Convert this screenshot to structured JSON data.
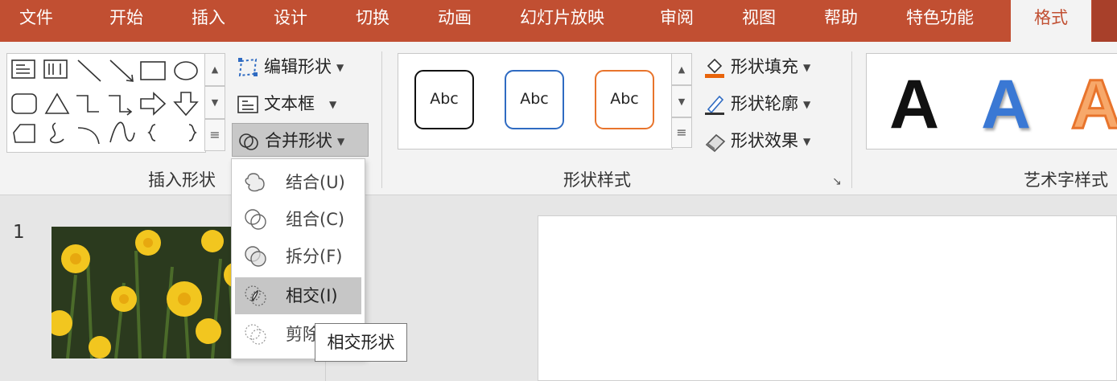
{
  "tabs": [
    "文件",
    "开始",
    "插入",
    "设计",
    "切换",
    "动画",
    "幻灯片放映",
    "审阅",
    "视图",
    "帮助",
    "特色功能",
    "格式"
  ],
  "ribbon": {
    "insert_shapes": {
      "label": "插入形状",
      "edit_shape": "编辑形状",
      "text_box": "文本框",
      "merge_shapes": "合并形状"
    },
    "shape_styles": {
      "label": "形状样式",
      "samples": [
        "Abc",
        "Abc",
        "Abc"
      ],
      "fill": "形状填充",
      "outline": "形状轮廓",
      "effects": "形状效果"
    },
    "wordart_styles": {
      "label": "艺术字样式",
      "samples": [
        "A",
        "A",
        "A"
      ]
    }
  },
  "merge_menu": {
    "items": [
      {
        "label": "结合(U)",
        "icon": "union-icon"
      },
      {
        "label": "组合(C)",
        "icon": "combine-icon"
      },
      {
        "label": "拆分(F)",
        "icon": "fragment-icon"
      },
      {
        "label": "相交(I)",
        "icon": "intersect-icon",
        "highlighted": true
      },
      {
        "label": "剪除(S)",
        "icon": "subtract-icon"
      }
    ],
    "visible_last_label": "剪除"
  },
  "tooltip": "相交形状",
  "slides": {
    "number": "1"
  },
  "colors": {
    "tab_bar": "#c14f32",
    "active_tab_text": "#c14f32",
    "fill_accent": "#e8630a",
    "abc_blue": "#2f6bc2",
    "abc_orange": "#e8742c"
  }
}
